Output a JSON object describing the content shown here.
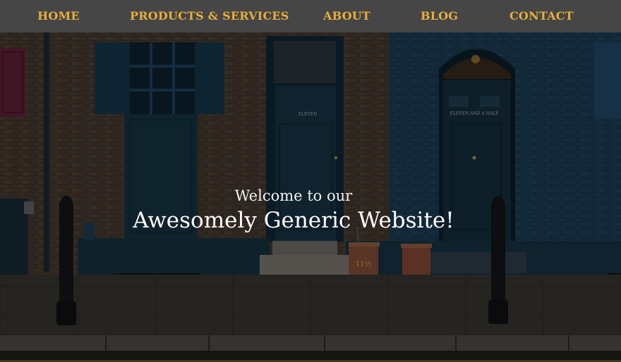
{
  "nav": {
    "items": [
      {
        "label": "HOME"
      },
      {
        "label": "PRODUCTS & SERVICES"
      },
      {
        "label": "ABOUT"
      },
      {
        "label": "BLOG"
      },
      {
        "label": "CONTACT"
      }
    ]
  },
  "hero": {
    "welcome": "Welcome to our",
    "headline": "Awesomely Generic Website!",
    "door_label_left": "ELEVEN",
    "door_label_right": "ELEVEN AND A HALF",
    "bin_label": "11½"
  },
  "colors": {
    "nav_bg": "#464646",
    "nav_text": "#e8ae3a",
    "brick": "#3a3128",
    "blue_wall": "#1b3a52",
    "door": "#142c3a",
    "pavement": "#2e2c2a"
  }
}
